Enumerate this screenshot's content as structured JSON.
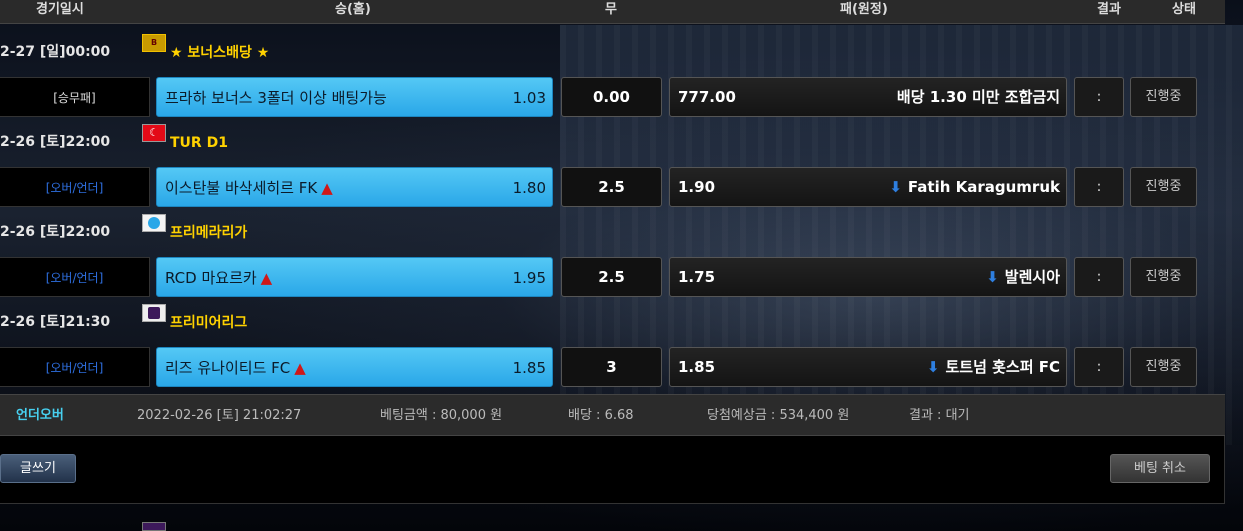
{
  "header": {
    "date_col": "경기일시",
    "home_col": "승(홈)",
    "draw_col": "무",
    "away_col": "패(원정)",
    "result_col": "결과",
    "status_col": "상태"
  },
  "matches": [
    {
      "date": "2-27 [일]00:00",
      "league": "★ 보너스배당 ★",
      "flag_icon": "bonus-icon",
      "type": "[승무패]",
      "home_team": "프라하 보너스 3폴더 이상 배팅가능",
      "home_odd": "1.03",
      "home_arrow": "",
      "draw": "0.00",
      "away_odd": "777.00",
      "away_team": "배당 1.30 미만 조합금지",
      "away_arrow": "",
      "result": ":",
      "status": "진행중"
    },
    {
      "date": "2-26 [토]22:00",
      "league": "TUR D1",
      "flag_icon": "turkey-flag-icon",
      "type": "[오버/언더]",
      "home_team": "이스탄불 바삭세히르 FK",
      "home_odd": "1.80",
      "home_arrow": "▲",
      "draw": "2.5",
      "away_odd": "1.90",
      "away_team": "Fatih Karagumruk",
      "away_arrow": "⬇",
      "result": ":",
      "status": "진행중"
    },
    {
      "date": "2-26 [토]22:00",
      "league": "프리메라리가",
      "flag_icon": "laliga-icon",
      "type": "[오버/언더]",
      "home_team": "RCD 마요르카",
      "home_odd": "1.95",
      "home_arrow": "▲",
      "draw": "2.5",
      "away_odd": "1.75",
      "away_team": "발렌시아",
      "away_arrow": "⬇",
      "result": ":",
      "status": "진행중"
    },
    {
      "date": "2-26 [토]21:30",
      "league": "프리미어리그",
      "flag_icon": "premier-league-icon",
      "type": "[오버/언더]",
      "home_team": "리즈 유나이티드 FC",
      "home_odd": "1.85",
      "home_arrow": "▲",
      "draw": "3",
      "away_odd": "1.85",
      "away_team": "토트넘 홋스퍼 FC",
      "away_arrow": "⬇",
      "result": ":",
      "status": "진행중"
    }
  ],
  "summary": {
    "bet_type": "언더오버",
    "datetime": "2022-02-26 [토] 21:02:27",
    "bet_amount": "베팅금액 : 80,000 원",
    "odds": "배당 : 6.68",
    "expected_win": "당첨예상금 : 534,400 원",
    "result": "결과 : 대기"
  },
  "actions": {
    "write_label": "글쓰기",
    "cancel_label": "베팅 취소"
  },
  "colors": {
    "home_box": "#2aa7e8",
    "league_text": "#ffd200",
    "up_arrow": "#d01818",
    "down_arrow": "#2e7fe0",
    "summary_accent": "#47d0f0",
    "type_link": "#2e6fe0"
  }
}
